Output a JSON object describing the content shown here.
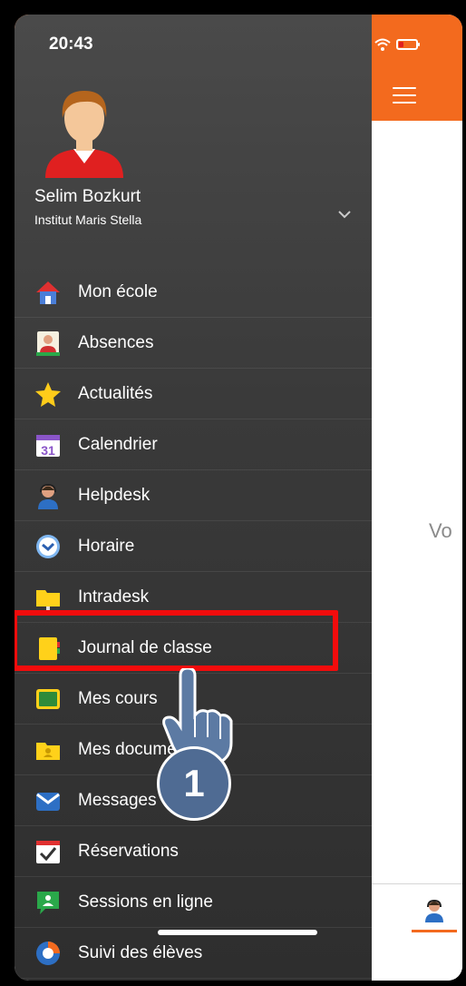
{
  "status": {
    "time": "20:43"
  },
  "app": {
    "body_text": "Vo"
  },
  "user": {
    "name": "Selim Bozkurt",
    "school": "Institut Maris Stella"
  },
  "menu": [
    {
      "label": "Mon école",
      "icon": "home-icon"
    },
    {
      "label": "Absences",
      "icon": "absences-icon"
    },
    {
      "label": "Actualités",
      "icon": "star-icon"
    },
    {
      "label": "Calendrier",
      "icon": "calendar-icon",
      "icon_text": "31"
    },
    {
      "label": "Helpdesk",
      "icon": "helpdesk-icon"
    },
    {
      "label": "Horaire",
      "icon": "clock-icon"
    },
    {
      "label": "Intradesk",
      "icon": "folder-icon"
    },
    {
      "label": "Journal de classe",
      "icon": "notebook-icon"
    },
    {
      "label": "Mes cours",
      "icon": "blackboard-icon"
    },
    {
      "label": "Mes documents",
      "icon": "documents-folder-icon"
    },
    {
      "label": "Messages",
      "icon": "mail-icon"
    },
    {
      "label": "Réservations",
      "icon": "reservation-icon"
    },
    {
      "label": "Sessions en ligne",
      "icon": "chat-icon"
    },
    {
      "label": "Suivi des élèves",
      "icon": "tracking-icon"
    }
  ],
  "annotation": {
    "step": "1"
  },
  "colors": {
    "accent": "#f36a1e",
    "highlight": "#f20c0c",
    "badge": "#4f6b93"
  }
}
